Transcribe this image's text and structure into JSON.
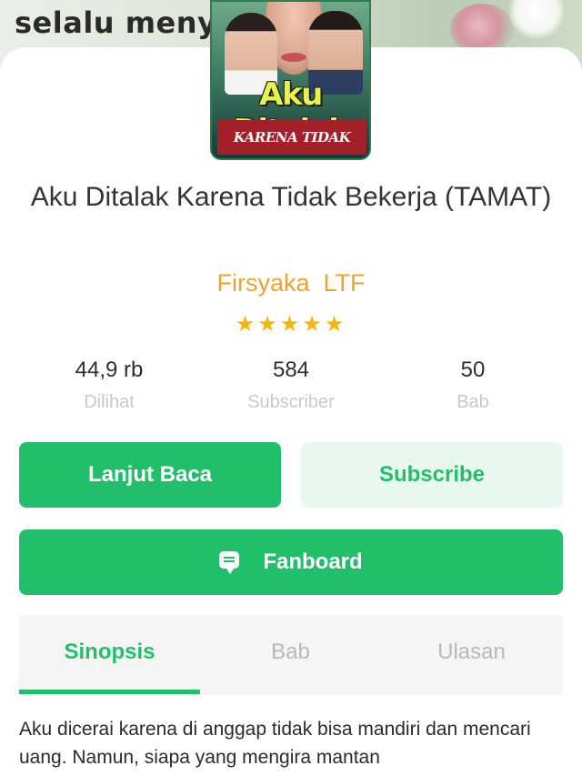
{
  "banner": {
    "text": "selalu menyd"
  },
  "cover": {
    "title_line1": "Aku Ditalak",
    "title_line2": "KARENA TIDAK BEKERJA"
  },
  "book": {
    "title": "Aku Ditalak Karena Tidak Bekerja (TAMAT)",
    "author": "Firsyaka  LTF",
    "rating_stars": "★★★★★",
    "rating_value": 5
  },
  "stats": [
    {
      "value": "44,9 rb",
      "label": "Dilihat"
    },
    {
      "value": "584",
      "label": "Subscriber"
    },
    {
      "value": "50",
      "label": "Bab"
    }
  ],
  "actions": {
    "read_label": "Lanjut Baca",
    "subscribe_label": "Subscribe",
    "fanboard_label": "Fanboard"
  },
  "tabs": [
    {
      "label": "Sinopsis",
      "active": true
    },
    {
      "label": "Bab",
      "active": false
    },
    {
      "label": "Ulasan",
      "active": false
    }
  ],
  "synopsis": "Aku dicerai karena di anggap tidak bisa mandiri dan mencari uang. Namun, siapa yang mengira mantan",
  "colors": {
    "accent": "#22bf6b",
    "accent_light": "#e9f8ef",
    "author": "#f0a32b",
    "star": "#f5b50a"
  }
}
